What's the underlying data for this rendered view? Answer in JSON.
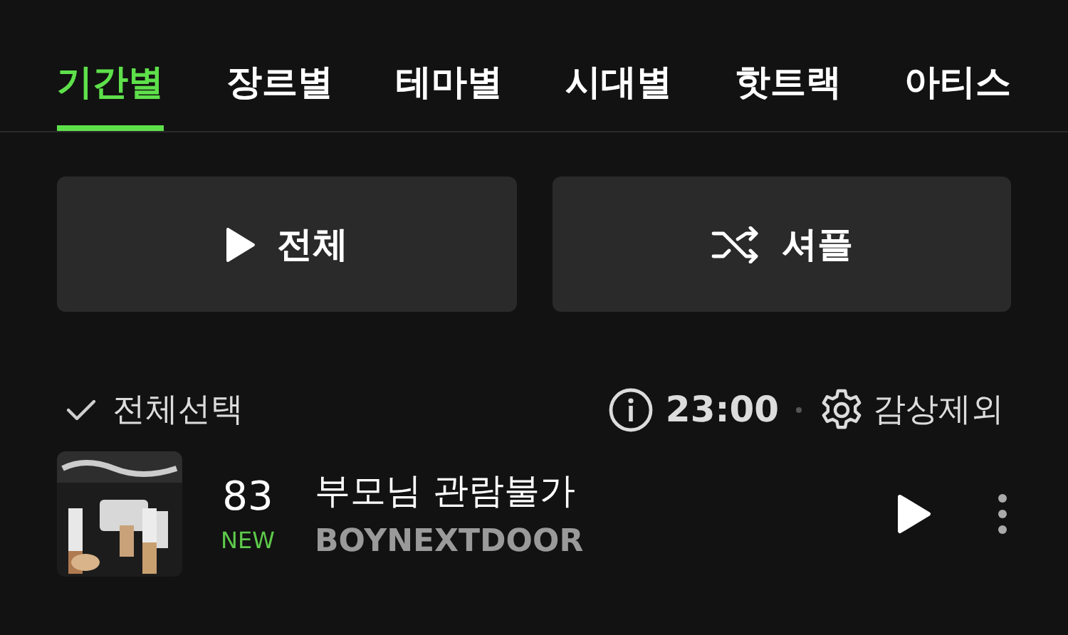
{
  "tabs": [
    {
      "label": "기간별",
      "selected": true
    },
    {
      "label": "장르별",
      "selected": false
    },
    {
      "label": "테마별",
      "selected": false
    },
    {
      "label": "시대별",
      "selected": false
    },
    {
      "label": "핫트랙",
      "selected": false
    },
    {
      "label": "아티스",
      "selected": false
    }
  ],
  "actions": [
    {
      "kind": "play",
      "label": "전체"
    },
    {
      "kind": "shuffle",
      "label": "셔플"
    }
  ],
  "toolbar": {
    "select_all": "전체선택",
    "timer": "23:00",
    "exclude": "감상제외"
  },
  "tracks": [
    {
      "rank": "83",
      "badge": "NEW",
      "title": "부모님 관람불가",
      "artist": "BOYNEXTDOOR"
    }
  ]
}
